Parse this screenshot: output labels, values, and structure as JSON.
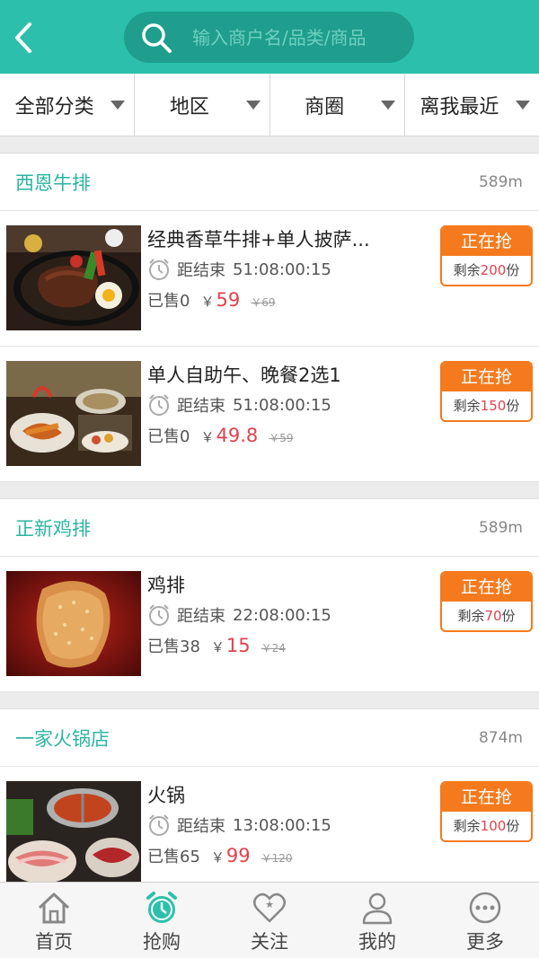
{
  "search": {
    "placeholder": "输入商户名/品类/商品"
  },
  "filters": [
    "全部分类",
    "地区",
    "商圈",
    "离我最近"
  ],
  "shops": [
    {
      "name": "西恩牛排",
      "distance": "589m",
      "deals": [
        {
          "title": "经典香草牛排+单人披萨...",
          "timer_label": "距结束",
          "timer": "51:08:00:15",
          "sold": "已售0",
          "yen": "￥",
          "price": "59",
          "old": "￥69",
          "badge": "正在抢",
          "remain_prefix": "剩余",
          "remain": "200",
          "remain_suffix": "份",
          "image": "steak-plate"
        },
        {
          "title": "单人自助午、晚餐2选1",
          "timer_label": "距结束",
          "timer": "51:08:00:15",
          "sold": "已售0",
          "yen": "￥",
          "price": "49.8",
          "old": "￥59",
          "badge": "正在抢",
          "remain_prefix": "剩余",
          "remain": "150",
          "remain_suffix": "份",
          "image": "buffet-table"
        }
      ]
    },
    {
      "name": "正新鸡排",
      "distance": "589m",
      "deals": [
        {
          "title": "鸡排",
          "timer_label": "距结束",
          "timer": "22:08:00:15",
          "sold": "已售38",
          "yen": "￥",
          "price": "15",
          "old": "￥24",
          "badge": "正在抢",
          "remain_prefix": "剩余",
          "remain": "70",
          "remain_suffix": "份",
          "image": "fried-chicken"
        }
      ]
    },
    {
      "name": "一家火锅店",
      "distance": "874m",
      "deals": [
        {
          "title": "火锅",
          "timer_label": "距结束",
          "timer": "13:08:00:15",
          "sold": "已售65",
          "yen": "￥",
          "price": "99",
          "old": "￥120",
          "badge": "正在抢",
          "remain_prefix": "剩余",
          "remain": "100",
          "remain_suffix": "份",
          "image": "hotpot"
        }
      ]
    }
  ],
  "tabbar": [
    {
      "label": "首页",
      "icon": "home-icon",
      "active": false
    },
    {
      "label": "抢购",
      "icon": "alarm-clock-icon",
      "active": true
    },
    {
      "label": "关注",
      "icon": "heart-icon",
      "active": false
    },
    {
      "label": "我的",
      "icon": "user-icon",
      "active": false
    },
    {
      "label": "更多",
      "icon": "more-icon",
      "active": false
    }
  ],
  "colors": {
    "brand": "#2cc0ac",
    "accent": "#f57a1e",
    "price": "#e0424d"
  }
}
